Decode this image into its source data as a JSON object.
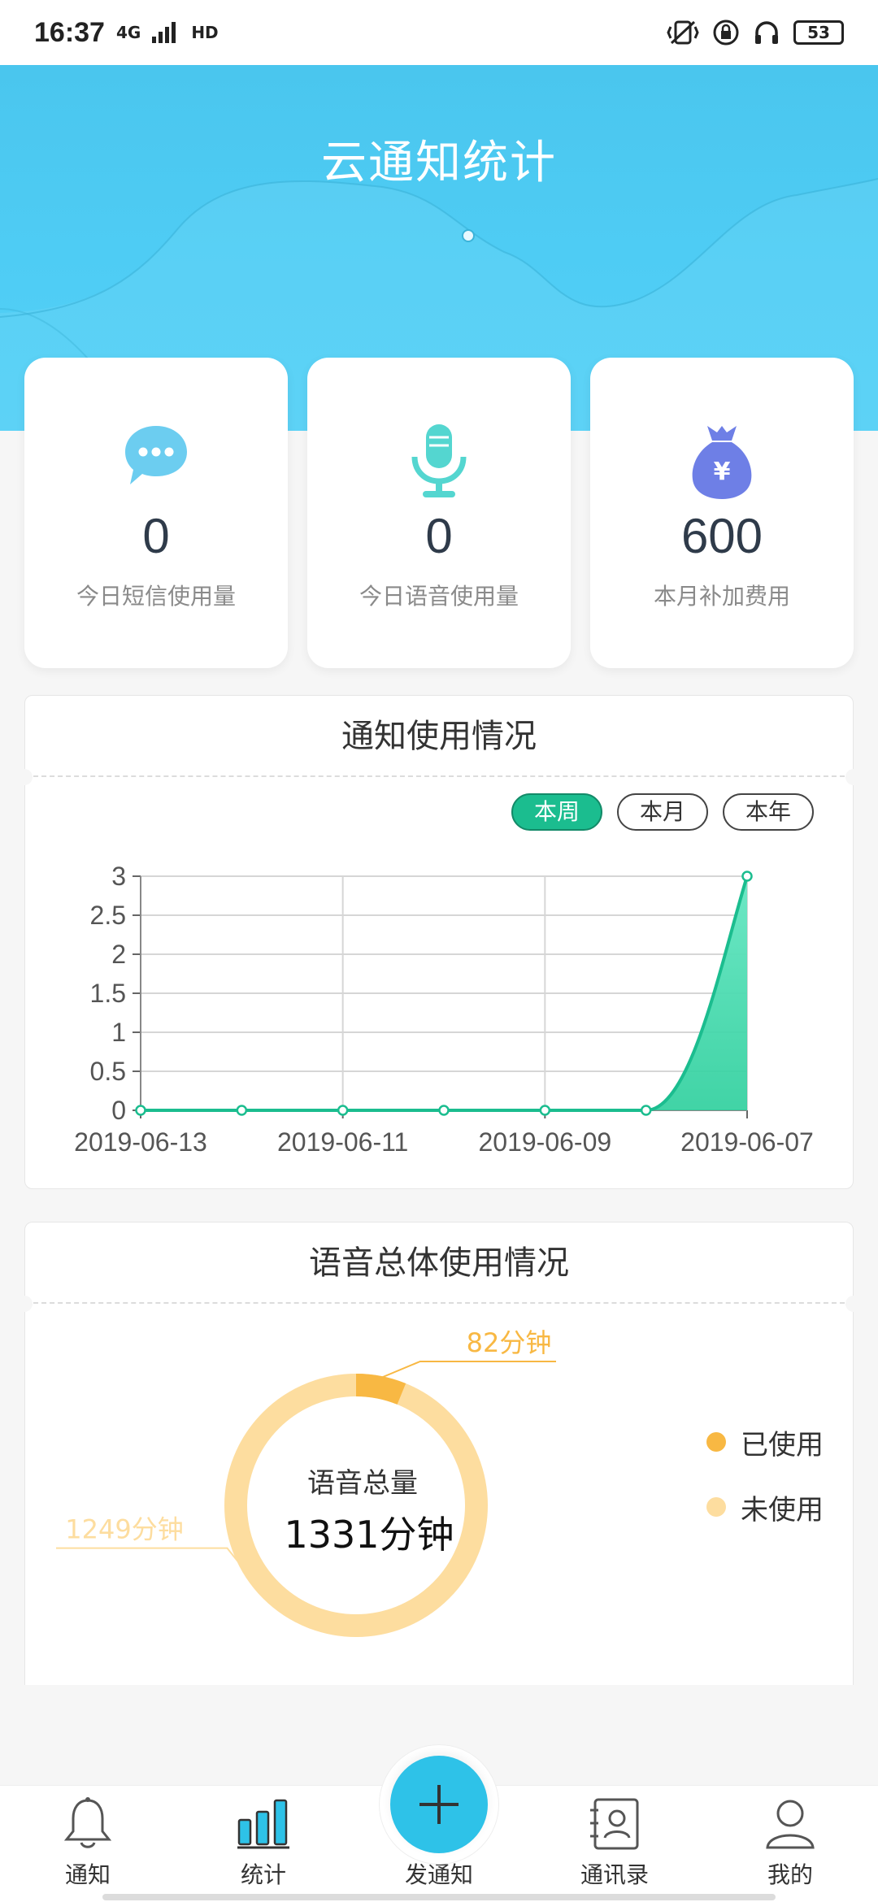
{
  "status_bar": {
    "time": "16:37",
    "network": "4G",
    "hd": "HD",
    "battery": "53"
  },
  "header": {
    "title": "云通知统计"
  },
  "stats": [
    {
      "icon": "sms-bubble-icon",
      "value": "0",
      "label": "今日短信使用量"
    },
    {
      "icon": "microphone-icon",
      "value": "0",
      "label": "今日语音使用量"
    },
    {
      "icon": "money-bag-icon",
      "value": "600",
      "label": "本月补加费用"
    }
  ],
  "notice_panel": {
    "title": "通知使用情况",
    "toggles": [
      "本周",
      "本月",
      "本年"
    ],
    "active_toggle": "本周"
  },
  "voice_panel": {
    "title": "语音总体使用情况",
    "center_label": "语音总量",
    "center_value": "1331分钟",
    "used_label": "82分钟",
    "unused_label": "1249分钟",
    "legend": [
      "已使用",
      "未使用"
    ]
  },
  "colors": {
    "accent": "#1bbd8f",
    "header": "#4fcdf5",
    "used": "#f8b843",
    "unused": "#fddd9f"
  },
  "chart_data": [
    {
      "type": "area",
      "x": [
        "2019-06-13",
        "2019-06-12",
        "2019-06-11",
        "2019-06-10",
        "2019-06-09",
        "2019-06-08",
        "2019-06-07"
      ],
      "x_tick_labels": [
        "2019-06-13",
        "2019-06-11",
        "2019-06-09",
        "2019-06-07"
      ],
      "values": [
        0,
        0,
        0,
        0,
        0,
        0,
        3
      ],
      "yticks": [
        "0",
        "0.5",
        "1",
        "1.5",
        "2",
        "2.5",
        "3"
      ],
      "ylim": [
        0,
        3
      ],
      "grid": true
    },
    {
      "type": "pie",
      "labels": [
        "已使用",
        "未使用"
      ],
      "values": [
        82,
        1249
      ],
      "total": 1331
    }
  ],
  "bottom_nav": [
    {
      "icon": "bell-icon",
      "label": "通知"
    },
    {
      "icon": "bar-chart-icon",
      "label": "统计"
    },
    {
      "icon": "plus-icon",
      "label": "发通知"
    },
    {
      "icon": "contacts-icon",
      "label": "通讯录"
    },
    {
      "icon": "user-icon",
      "label": "我的"
    }
  ]
}
